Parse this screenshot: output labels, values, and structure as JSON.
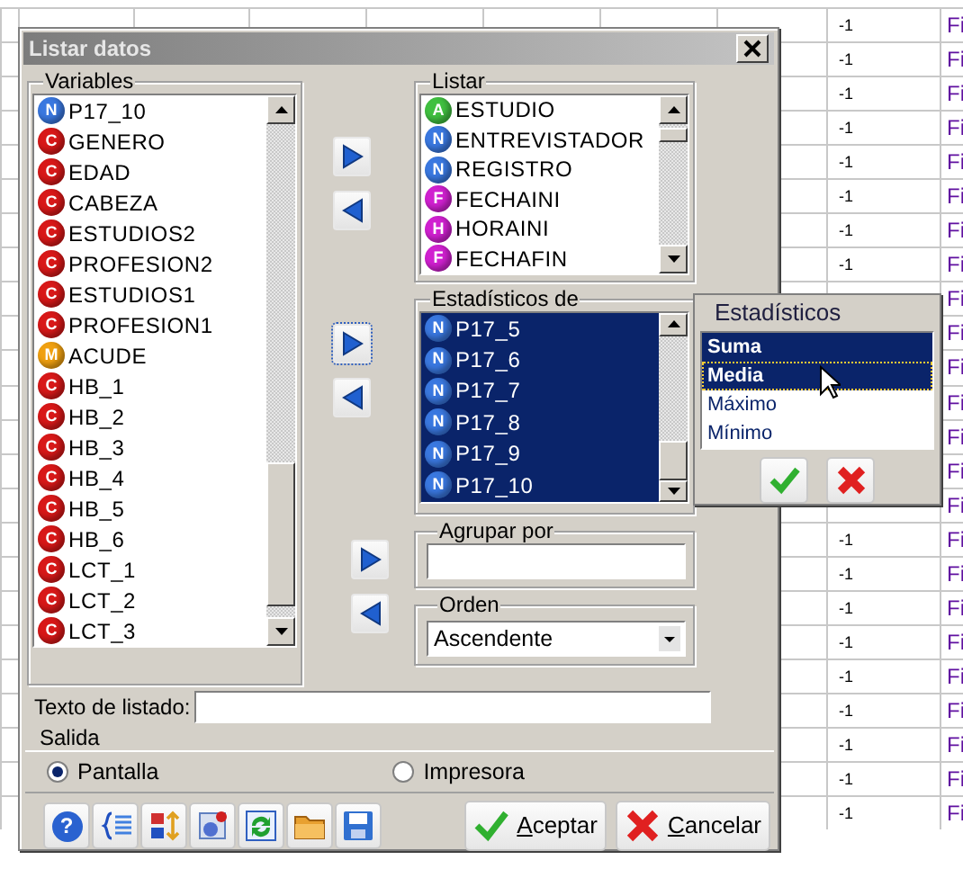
{
  "sheet": {
    "rows": [
      {
        "column_8": "-1",
        "column_9": "Fi"
      },
      {
        "column_8": "-1",
        "column_9": "Fi"
      },
      {
        "column_8": "-1",
        "column_9": "Fi"
      },
      {
        "column_8": "-1",
        "column_9": "Fi"
      },
      {
        "column_8": "-1",
        "column_9": "Fi"
      },
      {
        "column_8": "-1",
        "column_9": "Fi"
      },
      {
        "column_8": "-1",
        "column_9": "Fi"
      },
      {
        "column_8": "-1",
        "column_9": "Fi"
      },
      {
        "column_9": "Fi"
      },
      {
        "column_9": "Fi"
      },
      {
        "column_9": "Fi"
      },
      {
        "column_9": "Fi"
      },
      {
        "column_9": "Fi"
      },
      {
        "column_9": "Fi"
      },
      {
        "column_9": "Fi"
      },
      {
        "column_8": "-1",
        "column_9": "Fi"
      },
      {
        "column_8": "-1",
        "column_9": "Fi"
      },
      {
        "column_8": "-1",
        "column_9": "Fi"
      },
      {
        "column_8": "-1",
        "column_9": "Fi"
      },
      {
        "column_8": "-1",
        "column_9": "Fi"
      },
      {
        "column_8": "-1",
        "column_9": "Fi"
      },
      {
        "column_8": "-1",
        "column_9": "Fi"
      },
      {
        "column_8": "-1",
        "column_9": "Fi"
      },
      {
        "column_8": "-1",
        "column_9": "Fi"
      }
    ]
  },
  "dialog": {
    "title": "Listar datos",
    "variables": {
      "label": "Variables",
      "items": [
        {
          "badge": "N",
          "color": "#3a78e0",
          "text": "P17_10"
        },
        {
          "badge": "C",
          "color": "#d81818",
          "text": "GENERO"
        },
        {
          "badge": "C",
          "color": "#d81818",
          "text": "EDAD"
        },
        {
          "badge": "C",
          "color": "#d81818",
          "text": "CABEZA"
        },
        {
          "badge": "C",
          "color": "#d81818",
          "text": "ESTUDIOS2"
        },
        {
          "badge": "C",
          "color": "#d81818",
          "text": "PROFESION2"
        },
        {
          "badge": "C",
          "color": "#d81818",
          "text": "ESTUDIOS1"
        },
        {
          "badge": "C",
          "color": "#d81818",
          "text": "PROFESION1"
        },
        {
          "badge": "M",
          "color": "#f0a010",
          "text": "ACUDE"
        },
        {
          "badge": "C",
          "color": "#d81818",
          "text": "HB_1"
        },
        {
          "badge": "C",
          "color": "#d81818",
          "text": "HB_2"
        },
        {
          "badge": "C",
          "color": "#d81818",
          "text": "HB_3"
        },
        {
          "badge": "C",
          "color": "#d81818",
          "text": "HB_4"
        },
        {
          "badge": "C",
          "color": "#d81818",
          "text": "HB_5"
        },
        {
          "badge": "C",
          "color": "#d81818",
          "text": "HB_6"
        },
        {
          "badge": "C",
          "color": "#d81818",
          "text": "LCT_1"
        },
        {
          "badge": "C",
          "color": "#d81818",
          "text": "LCT_2"
        },
        {
          "badge": "C",
          "color": "#d81818",
          "text": "LCT_3"
        }
      ]
    },
    "listar": {
      "label": "Listar",
      "items": [
        {
          "badge": "A",
          "color": "#40c040",
          "text": "ESTUDIO",
          "selected": false
        },
        {
          "badge": "N",
          "color": "#3a78e0",
          "text": "ENTREVISTADOR",
          "selected": false
        },
        {
          "badge": "N",
          "color": "#3a78e0",
          "text": "REGISTRO",
          "selected": false
        },
        {
          "badge": "F",
          "color": "#d020d0",
          "text": "FECHAINI",
          "selected": false
        },
        {
          "badge": "H",
          "color": "#d020d0",
          "text": "HORAINI",
          "selected": false
        },
        {
          "badge": "F",
          "color": "#d020d0",
          "text": "FECHAFIN",
          "selected": false
        }
      ]
    },
    "estadisticos_de": {
      "label": "Estadísticos de",
      "items": [
        {
          "badge": "N",
          "color": "#3a78e0",
          "text": "P17_5",
          "selected": true
        },
        {
          "badge": "N",
          "color": "#3a78e0",
          "text": "P17_6",
          "selected": true
        },
        {
          "badge": "N",
          "color": "#3a78e0",
          "text": "P17_7",
          "selected": true
        },
        {
          "badge": "N",
          "color": "#3a78e0",
          "text": "P17_8",
          "selected": true
        },
        {
          "badge": "N",
          "color": "#3a78e0",
          "text": "P17_9",
          "selected": true
        },
        {
          "badge": "N",
          "color": "#3a78e0",
          "text": "P17_10",
          "selected": true
        }
      ]
    },
    "agrupar_por": {
      "label": "Agrupar por"
    },
    "orden": {
      "label": "Orden",
      "value": "Ascendente"
    },
    "texto_de_listado": {
      "label": "Texto de listado:"
    },
    "salida": {
      "label": "Salida",
      "options": [
        {
          "label": "Pantalla",
          "selected": true
        },
        {
          "label": "Impresora",
          "selected": false
        }
      ]
    },
    "help_button": "?",
    "buttons": [
      {
        "kind": "accept",
        "label": "Aceptar"
      },
      {
        "kind": "cancel",
        "label": "Cancelar"
      }
    ]
  },
  "popup": {
    "title": "Estadísticos",
    "items": [
      {
        "text": "Suma",
        "selected": true,
        "focused": false
      },
      {
        "text": "Media",
        "selected": true,
        "focused": true
      },
      {
        "text": "Máximo",
        "selected": false,
        "focused": false
      },
      {
        "text": "Mínimo",
        "selected": false,
        "focused": false
      }
    ]
  }
}
